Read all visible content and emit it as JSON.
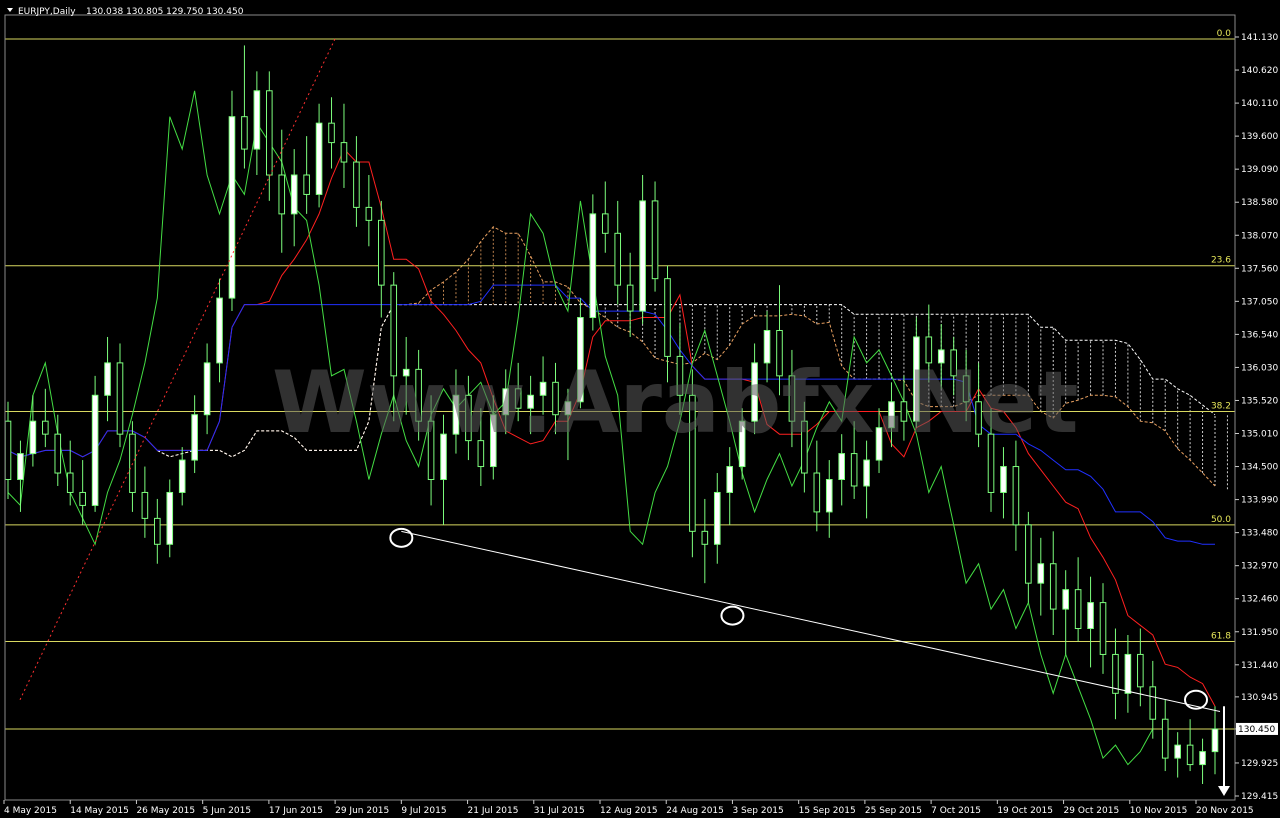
{
  "header": {
    "symbol_text": "EURJPY,Daily",
    "ohlc_text": "130.038 130.805 129.750 130.450"
  },
  "watermark": "Www.Arabfx.Net",
  "colors": {
    "background": "#000000",
    "candle": "#7dff7d",
    "candle_body_up": "#ffffff",
    "tenkan": "#ff2020",
    "kijun": "#2030ff",
    "chikou": "#44dd44",
    "kumo_bull": "#e8a060",
    "kumo_bear": "#ffffff",
    "fib_level": "#d8d860",
    "trendline": "#ffffff",
    "extension": "#ff3030"
  },
  "chart_data": {
    "type": "candlestick",
    "instrument": "EURJPY",
    "timeframe": "Daily",
    "ylim": [
      129.2,
      141.5
    ],
    "y_ticks": [
      "141.130",
      "140.620",
      "140.110",
      "139.600",
      "139.090",
      "138.580",
      "138.070",
      "137.560",
      "137.050",
      "136.540",
      "136.030",
      "135.520",
      "135.010",
      "134.500",
      "133.990",
      "133.480",
      "132.970",
      "132.460",
      "131.950",
      "131.440",
      "130.945",
      "130.450",
      "129.925",
      "129.415"
    ],
    "current_price": "130.450",
    "x_tick_labels": [
      "4 May 2015",
      "14 May 2015",
      "26 May 2015",
      "5 Jun 2015",
      "17 Jun 2015",
      "29 Jun 2015",
      "9 Jul 2015",
      "21 Jul 2015",
      "31 Jul 2015",
      "12 Aug 2015",
      "24 Aug 2015",
      "3 Sep 2015",
      "15 Sep 2015",
      "25 Sep 2015",
      "7 Oct 2015",
      "19 Oct 2015",
      "29 Oct 2015",
      "10 Nov 2015",
      "20 Nov 2015"
    ],
    "fib_levels": [
      {
        "label": "0.0",
        "value": 141.1
      },
      {
        "label": "23.6",
        "value": 137.6
      },
      {
        "label": "38.2",
        "value": 135.35
      },
      {
        "label": "50.0",
        "value": 133.6
      },
      {
        "label": "61.8",
        "value": 131.8
      },
      {
        "label": "",
        "value": 130.45
      }
    ],
    "candles": [
      [
        135.2,
        135.5,
        134.0,
        134.3
      ],
      [
        134.3,
        134.9,
        133.8,
        134.7
      ],
      [
        134.7,
        135.6,
        134.5,
        135.2
      ],
      [
        135.2,
        135.7,
        134.8,
        135.0
      ],
      [
        135.0,
        135.3,
        134.2,
        134.4
      ],
      [
        134.4,
        134.9,
        133.9,
        134.1
      ],
      [
        134.1,
        134.6,
        133.6,
        133.9
      ],
      [
        133.9,
        135.9,
        133.8,
        135.6
      ],
      [
        135.6,
        136.5,
        135.2,
        136.1
      ],
      [
        136.1,
        136.4,
        134.8,
        135.0
      ],
      [
        135.0,
        135.2,
        133.8,
        134.1
      ],
      [
        134.1,
        134.5,
        133.4,
        133.7
      ],
      [
        133.7,
        134.0,
        133.0,
        133.3
      ],
      [
        133.3,
        134.3,
        133.1,
        134.1
      ],
      [
        134.1,
        134.8,
        133.9,
        134.6
      ],
      [
        134.6,
        135.6,
        134.4,
        135.3
      ],
      [
        135.3,
        136.4,
        135.0,
        136.1
      ],
      [
        136.1,
        137.4,
        135.8,
        137.1
      ],
      [
        137.1,
        140.3,
        136.9,
        139.9
      ],
      [
        139.9,
        141.0,
        139.1,
        139.4
      ],
      [
        139.4,
        140.6,
        139.0,
        140.3
      ],
      [
        140.3,
        140.6,
        138.6,
        139.0
      ],
      [
        139.0,
        139.7,
        137.8,
        138.4
      ],
      [
        138.4,
        139.4,
        137.9,
        139.0
      ],
      [
        139.0,
        139.6,
        138.4,
        138.7
      ],
      [
        138.7,
        140.1,
        138.5,
        139.8
      ],
      [
        139.8,
        140.2,
        139.1,
        139.5
      ],
      [
        139.5,
        140.1,
        138.8,
        139.2
      ],
      [
        139.2,
        139.6,
        138.2,
        138.5
      ],
      [
        138.5,
        139.0,
        137.9,
        138.3
      ],
      [
        138.3,
        138.6,
        136.8,
        137.3
      ],
      [
        137.3,
        137.5,
        135.2,
        135.9
      ],
      [
        135.9,
        136.5,
        135.3,
        136.0
      ],
      [
        136.0,
        136.3,
        134.9,
        135.2
      ],
      [
        135.2,
        135.6,
        133.9,
        134.3
      ],
      [
        134.3,
        135.3,
        133.6,
        135.0
      ],
      [
        135.0,
        136.0,
        134.7,
        135.6
      ],
      [
        135.6,
        135.9,
        134.6,
        134.9
      ],
      [
        134.9,
        135.4,
        134.2,
        134.5
      ],
      [
        134.5,
        135.6,
        134.3,
        135.3
      ],
      [
        135.3,
        136.0,
        135.0,
        135.7
      ],
      [
        135.7,
        136.1,
        135.2,
        135.4
      ],
      [
        135.4,
        135.9,
        135.0,
        135.6
      ],
      [
        135.6,
        136.2,
        135.3,
        135.8
      ],
      [
        135.8,
        136.1,
        135.0,
        135.3
      ],
      [
        135.3,
        135.7,
        134.6,
        135.5
      ],
      [
        135.5,
        137.1,
        135.4,
        136.8
      ],
      [
        136.8,
        138.7,
        136.6,
        138.4
      ],
      [
        138.4,
        138.9,
        137.8,
        138.1
      ],
      [
        138.1,
        138.6,
        137.0,
        137.3
      ],
      [
        137.3,
        137.8,
        136.5,
        136.9
      ],
      [
        136.9,
        139.0,
        136.7,
        138.6
      ],
      [
        138.6,
        138.9,
        137.2,
        137.4
      ],
      [
        137.4,
        137.6,
        135.8,
        136.2
      ],
      [
        136.2,
        136.7,
        135.3,
        135.6
      ],
      [
        135.6,
        136.0,
        133.1,
        133.5
      ],
      [
        133.5,
        134.0,
        132.7,
        133.3
      ],
      [
        133.3,
        134.4,
        133.0,
        134.1
      ],
      [
        134.1,
        134.8,
        133.6,
        134.5
      ],
      [
        134.5,
        135.4,
        134.3,
        135.2
      ],
      [
        135.2,
        136.4,
        135.0,
        136.1
      ],
      [
        136.1,
        136.9,
        135.8,
        136.6
      ],
      [
        136.6,
        137.3,
        135.6,
        135.9
      ],
      [
        135.9,
        136.3,
        134.8,
        135.2
      ],
      [
        135.2,
        135.5,
        134.1,
        134.4
      ],
      [
        134.4,
        134.9,
        133.5,
        133.8
      ],
      [
        133.8,
        134.6,
        133.4,
        134.3
      ],
      [
        134.3,
        135.0,
        133.9,
        134.7
      ],
      [
        134.7,
        135.2,
        134.0,
        134.2
      ],
      [
        134.2,
        134.9,
        133.7,
        134.6
      ],
      [
        134.6,
        135.4,
        134.4,
        135.1
      ],
      [
        135.1,
        135.8,
        134.8,
        135.5
      ],
      [
        135.5,
        135.9,
        134.9,
        135.2
      ],
      [
        135.2,
        136.8,
        135.1,
        136.5
      ],
      [
        136.5,
        137.0,
        135.8,
        136.1
      ],
      [
        136.1,
        136.7,
        135.7,
        136.3
      ],
      [
        136.3,
        136.5,
        135.6,
        135.9
      ],
      [
        135.9,
        136.3,
        135.2,
        135.5
      ],
      [
        135.5,
        136.1,
        134.8,
        135.0
      ],
      [
        135.0,
        135.4,
        133.8,
        134.1
      ],
      [
        134.1,
        134.8,
        133.7,
        134.5
      ],
      [
        134.5,
        134.9,
        133.2,
        133.6
      ],
      [
        133.6,
        133.8,
        132.4,
        132.7
      ],
      [
        132.7,
        133.4,
        132.2,
        133.0
      ],
      [
        133.0,
        133.5,
        131.9,
        132.3
      ],
      [
        132.3,
        132.9,
        131.6,
        132.6
      ],
      [
        132.6,
        133.1,
        131.8,
        132.0
      ],
      [
        132.0,
        132.8,
        131.4,
        132.4
      ],
      [
        132.4,
        132.7,
        131.3,
        131.6
      ],
      [
        131.6,
        132.0,
        130.6,
        131.0
      ],
      [
        131.0,
        131.9,
        130.7,
        131.6
      ],
      [
        131.6,
        132.0,
        130.8,
        131.1
      ],
      [
        131.1,
        131.5,
        130.3,
        130.6
      ],
      [
        130.6,
        130.9,
        129.8,
        130.0
      ],
      [
        130.0,
        130.4,
        129.7,
        130.2
      ],
      [
        130.2,
        130.6,
        129.8,
        129.9
      ],
      [
        129.9,
        130.3,
        129.6,
        130.1
      ],
      [
        130.1,
        130.8,
        129.75,
        130.45
      ]
    ],
    "annotations": {
      "trendline_points": [
        [
          "9 Jul 2015",
          133.5
        ],
        [
          "20 Nov 2015",
          130.8
        ]
      ],
      "circled_points": [
        [
          "9 Jul 2015",
          133.4
        ],
        [
          "3 Sep 2015",
          132.2
        ],
        [
          "20 Nov 2015",
          130.9
        ]
      ],
      "down_arrow_target": 129.415
    }
  }
}
